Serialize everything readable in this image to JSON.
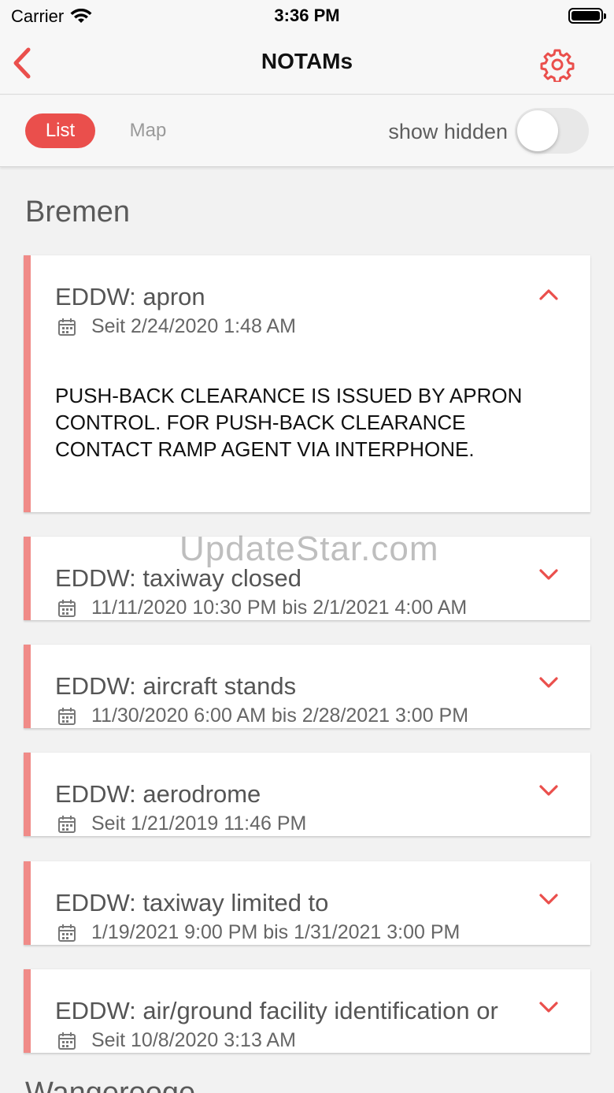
{
  "status_bar": {
    "carrier": "Carrier",
    "time": "3:36 PM"
  },
  "nav": {
    "title": "NOTAMs",
    "accent_color": "#ea4f4c"
  },
  "segments": {
    "list_label": "List",
    "map_label": "Map",
    "active": "List"
  },
  "show_hidden": {
    "label": "show hidden",
    "enabled": false
  },
  "sections": [
    {
      "title": "Bremen",
      "notams": [
        {
          "title": "EDDW: apron",
          "date": "Seit 2/24/2020 1:48 AM",
          "expanded": true,
          "body": "PUSH-BACK CLEARANCE IS ISSUED BY APRON CONTROL. FOR PUSH-BACK CLEARANCE CONTACT RAMP AGENT VIA INTERPHONE."
        },
        {
          "title": "EDDW: taxiway closed",
          "date": "11/11/2020 10:30 PM bis 2/1/2021 4:00 AM",
          "expanded": false
        },
        {
          "title": "EDDW: aircraft stands",
          "date": "11/30/2020 6:00 AM bis 2/28/2021 3:00 PM",
          "expanded": false
        },
        {
          "title": "EDDW: aerodrome",
          "date": "Seit 1/21/2019 11:46 PM",
          "expanded": false
        },
        {
          "title": "EDDW: taxiway limited to",
          "date": "1/19/2021 9:00 PM bis 1/31/2021 3:00 PM",
          "expanded": false
        },
        {
          "title": "EDDW: air/ground facility identification or",
          "date": "Seit 10/8/2020 3:13 AM",
          "expanded": false
        }
      ]
    },
    {
      "title": "Wangerooge"
    }
  ],
  "watermark": "UpdateStar.com",
  "icons": {
    "back": "chevron-left-icon",
    "settings": "gear-icon",
    "calendar": "calendar-icon",
    "expand": "chevron-down-icon",
    "collapse": "chevron-up-icon",
    "wifi": "wifi-icon",
    "battery": "battery-icon"
  }
}
